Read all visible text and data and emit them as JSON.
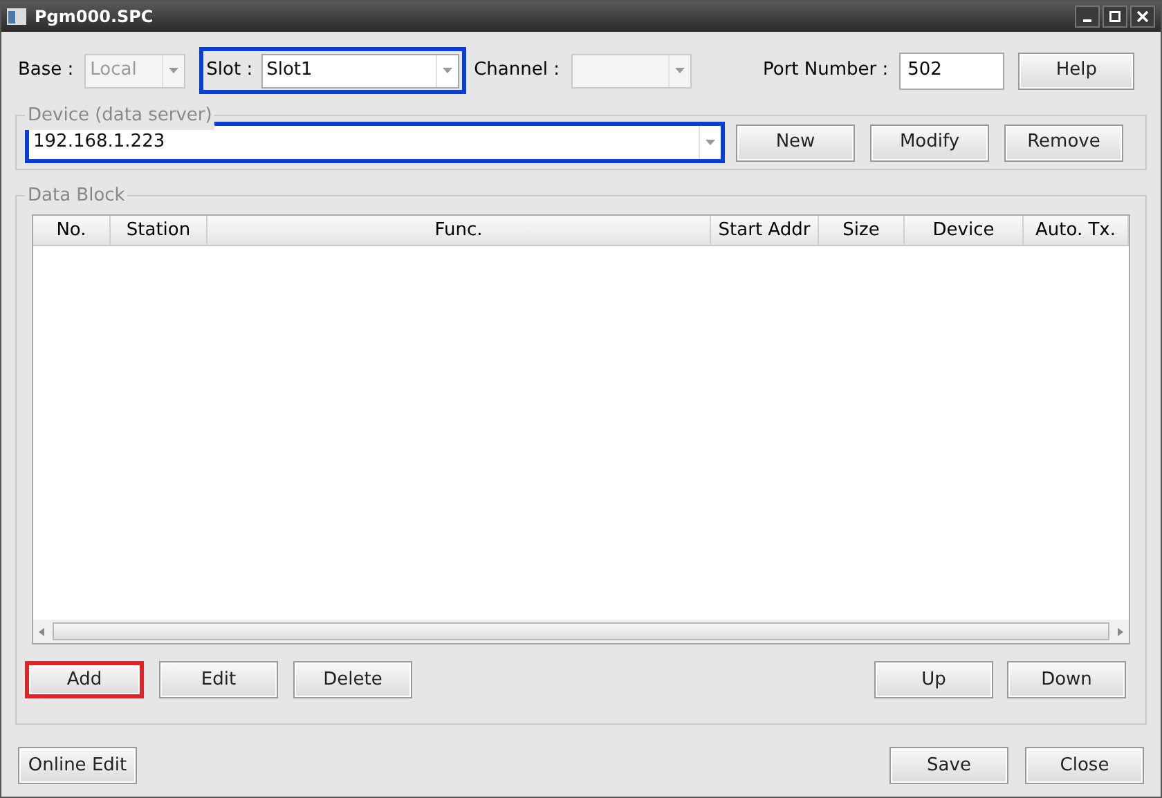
{
  "window": {
    "title": "Pgm000.SPC"
  },
  "base": {
    "label": "Base :",
    "value": "Local",
    "disabled": true
  },
  "slot": {
    "label": "Slot :",
    "value": "Slot1",
    "disabled": false,
    "highlighted": true,
    "color": "#0a3fd6"
  },
  "channel": {
    "label": "Channel :",
    "disabled": true
  },
  "port": {
    "label": "Port Number :",
    "value": "502"
  },
  "help_button": "Help",
  "device": {
    "legend": "Device (data server)",
    "value": "192.168.1.223",
    "highlighted": true,
    "color": "#0a3fd6"
  },
  "device_buttons": [
    "New",
    "Modify",
    "Remove"
  ],
  "data_block": {
    "legend": "Data Block",
    "columns": [
      "No.",
      "Station",
      "Func.",
      "Start Addr",
      "Size",
      "Device",
      "Auto. Tx."
    ]
  },
  "block_buttons_left": [
    {
      "label": "Add",
      "highlighted": true,
      "color": "#d8262b"
    },
    {
      "label": "Edit",
      "highlighted": false
    },
    {
      "label": "Delete",
      "highlighted": false
    }
  ],
  "block_buttons_right": [
    "Up",
    "Down"
  ],
  "online_edit_button": "Online Edit",
  "footer_buttons": [
    "Save",
    "Close"
  ]
}
